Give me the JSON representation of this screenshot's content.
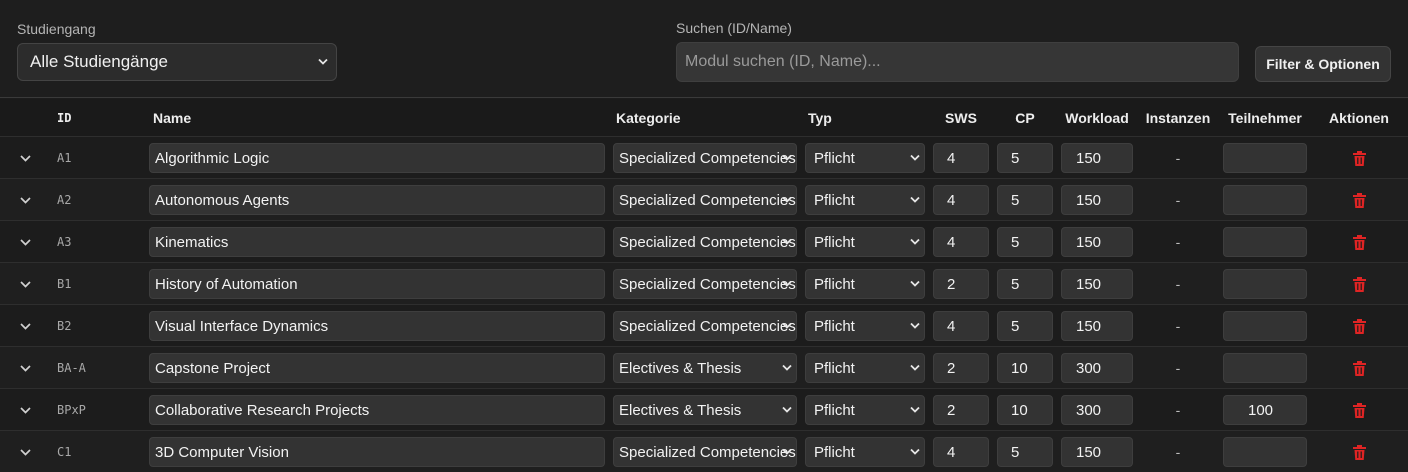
{
  "filters": {
    "studiengang_label": "Studiengang",
    "studiengang_value": "Alle Studiengänge",
    "search_label": "Suchen (ID/Name)",
    "search_placeholder": "Modul suchen (ID, Name)...",
    "filter_button": "Filter & Optionen"
  },
  "table": {
    "headers": {
      "id": "ID",
      "name": "Name",
      "kategorie": "Kategorie",
      "typ": "Typ",
      "sws": "SWS",
      "cp": "CP",
      "workload": "Workload",
      "instanzen": "Instanzen",
      "teilnehmer": "Teilnehmer",
      "aktionen": "Aktionen"
    },
    "rows": [
      {
        "id": "A1",
        "name": "Algorithmic Logic",
        "kategorie": "Specialized Competencies",
        "typ": "Pflicht",
        "sws": "4",
        "cp": "5",
        "workload": "150",
        "instanzen": "-",
        "teilnehmer": ""
      },
      {
        "id": "A2",
        "name": "Autonomous Agents",
        "kategorie": "Specialized Competencies",
        "typ": "Pflicht",
        "sws": "4",
        "cp": "5",
        "workload": "150",
        "instanzen": "-",
        "teilnehmer": ""
      },
      {
        "id": "A3",
        "name": "Kinematics",
        "kategorie": "Specialized Competencies",
        "typ": "Pflicht",
        "sws": "4",
        "cp": "5",
        "workload": "150",
        "instanzen": "-",
        "teilnehmer": ""
      },
      {
        "id": "B1",
        "name": "History of Automation",
        "kategorie": "Specialized Competencies",
        "typ": "Pflicht",
        "sws": "2",
        "cp": "5",
        "workload": "150",
        "instanzen": "-",
        "teilnehmer": ""
      },
      {
        "id": "B2",
        "name": "Visual Interface Dynamics",
        "kategorie": "Specialized Competencies",
        "typ": "Pflicht",
        "sws": "4",
        "cp": "5",
        "workload": "150",
        "instanzen": "-",
        "teilnehmer": ""
      },
      {
        "id": "BA-A",
        "name": "Capstone Project",
        "kategorie": "Electives & Thesis",
        "typ": "Pflicht",
        "sws": "2",
        "cp": "10",
        "workload": "300",
        "instanzen": "-",
        "teilnehmer": ""
      },
      {
        "id": "BPxP",
        "name": "Collaborative Research Projects",
        "kategorie": "Electives & Thesis",
        "typ": "Pflicht",
        "sws": "2",
        "cp": "10",
        "workload": "300",
        "instanzen": "-",
        "teilnehmer": "100"
      },
      {
        "id": "C1",
        "name": "3D Computer Vision",
        "kategorie": "Specialized Competencies",
        "typ": "Pflicht",
        "sws": "4",
        "cp": "5",
        "workload": "150",
        "instanzen": "-",
        "teilnehmer": ""
      }
    ]
  },
  "icons": {
    "expand": "chevron-down-icon",
    "delete": "trash-icon",
    "select": "chevron-down-icon"
  },
  "colors": {
    "delete": "#e02424",
    "background": "#1c1c1c"
  }
}
